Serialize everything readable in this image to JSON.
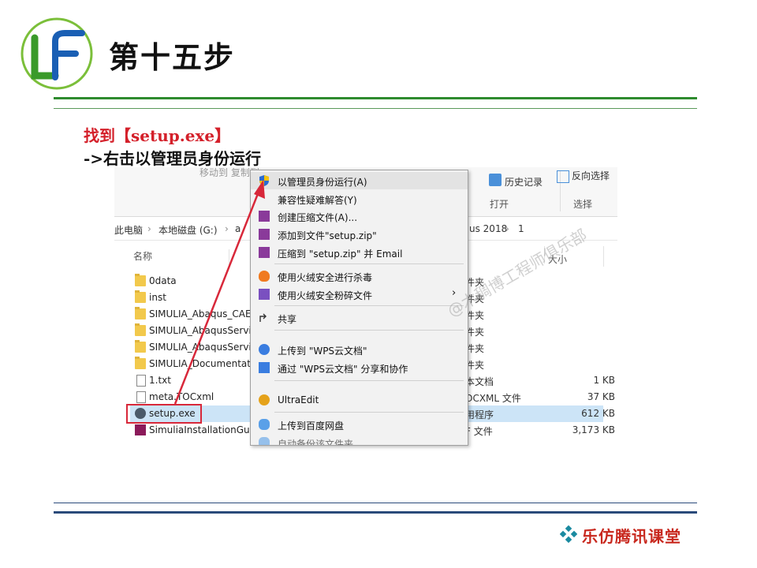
{
  "slide": {
    "title": "第十五步",
    "instruction_line1": "找到【setup.exe】",
    "instruction_line2": "->右击以管理员身份运行",
    "footer_brand": "乐仿腾讯课堂"
  },
  "colors": {
    "green_rule": "#2e8b2e",
    "navy_rule": "#2a4a7a",
    "highlight_red": "#d8283a",
    "selection_blue": "#cce4f7"
  },
  "ribbon": {
    "history_label": "历史记录",
    "open_group": "打开",
    "reverse_select": "反向选择",
    "select_group": "选择"
  },
  "address": {
    "pc": "此电脑",
    "disk": "本地磁盘 (G:)",
    "tail_seg1": "us 2018",
    "tail_seg2": "1"
  },
  "columns": {
    "name": "名称",
    "size": "大小"
  },
  "files": [
    {
      "name": "0data",
      "type": "件夹",
      "size": ""
    },
    {
      "name": "inst",
      "type": "件夹",
      "size": ""
    },
    {
      "name": "SIMULIA_Abaqus_CAE",
      "type": "件夹",
      "size": ""
    },
    {
      "name": "SIMULIA_AbaqusServi",
      "type": "件夹",
      "size": ""
    },
    {
      "name": "SIMULIA_AbaqusServi",
      "type": "件夹",
      "size": ""
    },
    {
      "name": "SIMULIA_Documentati",
      "type": "件夹",
      "size": ""
    },
    {
      "name": "1.txt",
      "type": "本文档",
      "size": "1 KB"
    },
    {
      "name": "meta.TOCxml",
      "type": "OCXML 文件",
      "size": "37 KB"
    },
    {
      "name": "setup.exe",
      "type": "用程序",
      "size": "612 KB"
    },
    {
      "name": "SimuliaInstallationGui",
      "type": "F 文件",
      "size": "3,173 KB"
    }
  ],
  "context_menu": {
    "run_as_admin": "以管理员身份运行(A)",
    "troubleshoot": "兼容性疑难解答(Y)",
    "create_archive": "创建压缩文件(A)...",
    "add_to_zip": "添加到文件\"setup.zip\"",
    "zip_email": "压缩到 \"setup.zip\" 并 Email",
    "huorong_scan": "使用火绒安全进行杀毒",
    "huorong_shred": "使用火绒安全粉碎文件",
    "share": "共享",
    "wps_upload": "上传到 \"WPS云文档\"",
    "wps_share": "通过 \"WPS云文档\" 分享和协作",
    "ultraedit": "UltraEdit",
    "baidu_upload": "上传到百度网盘",
    "auto_backup": "自动备份该文件夹"
  },
  "watermark": "@木稠博工程师俱乐部"
}
